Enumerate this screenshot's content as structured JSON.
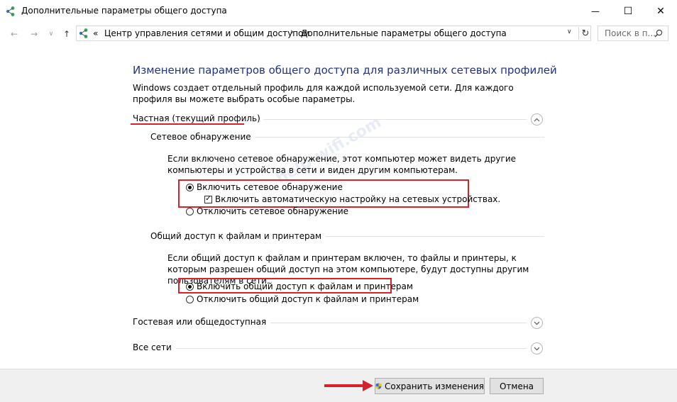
{
  "window": {
    "title": "Дополнительные параметры общего доступа",
    "minimize_glyph": "—",
    "maximize_glyph": "☐",
    "close_glyph": "✕"
  },
  "address_bar": {
    "prefix": "«",
    "crumbs": [
      "Центр управления сетями и общим доступом",
      "Дополнительные параметры общего доступа"
    ],
    "separator": "›",
    "search_placeholder": "Поиск в п..."
  },
  "content": {
    "heading": "Изменение параметров общего доступа для различных сетевых профилей",
    "description": "Windows создает отдельный профиль для каждой используемой сети. Для каждого профиля вы можете выбрать особые параметры.",
    "profile_private": {
      "title": "Частная (текущий профиль)",
      "network_discovery": {
        "title": "Сетевое обнаружение",
        "text": "Если включено сетевое обнаружение, этот компьютер может видеть другие компьютеры и устройства в сети и виден другим компьютерам.",
        "option_on": "Включить сетевое обнаружение",
        "auto_setup": "Включить автоматическую настройку на сетевых устройствах.",
        "option_off": "Отключить сетевое обнаружение"
      },
      "file_sharing": {
        "title": "Общий доступ к файлам и принтерам",
        "text": "Если общий доступ к файлам и принтерам включен, то файлы и принтеры, к которым разрешен общий доступ на этом компьютере, будут доступны другим пользователям в сети.",
        "option_on": "Включить общий доступ к файлам и принтерам",
        "option_off": "Отключить общий доступ к файлам и принтерам"
      }
    },
    "profile_guest": {
      "title": "Гостевая или общедоступная"
    },
    "profile_all": {
      "title": "Все сети"
    },
    "watermark": "help-wifi.com"
  },
  "footer": {
    "save_label": "Сохранить изменения",
    "cancel_label": "Отмена"
  },
  "colors": {
    "accent_red": "#d6232b",
    "heading_blue": "#1e3287"
  }
}
